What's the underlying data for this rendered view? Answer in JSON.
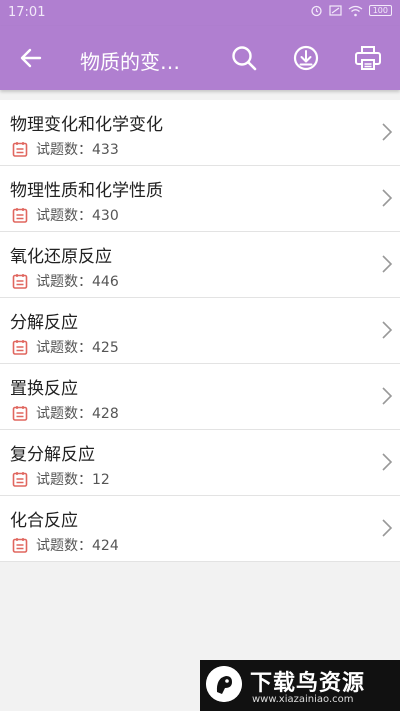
{
  "status_bar": {
    "time": "17:01",
    "battery": "100"
  },
  "app_bar": {
    "title": "物质的变…",
    "background": "#b07fd0"
  },
  "icons": {
    "back": "back-arrow-icon",
    "search": "search-icon",
    "download": "download-icon",
    "print": "print-icon",
    "item": "calendar-icon",
    "chevron": "chevron-right-icon"
  },
  "items": [
    {
      "name": "物理变化和化学变化",
      "count": "试题数：433"
    },
    {
      "name": "物理性质和化学性质",
      "count": "试题数：430"
    },
    {
      "name": "氧化还原反应",
      "count": "试题数：446"
    },
    {
      "name": "分解反应",
      "count": "试题数：425"
    },
    {
      "name": "置换反应",
      "count": "试题数：428"
    },
    {
      "name": "复分解反应",
      "count": "试题数：12"
    },
    {
      "name": "化合反应",
      "count": "试题数：424"
    }
  ],
  "watermark": {
    "brand": "下载鸟资源",
    "url": "www.xiazainiao.com"
  },
  "colors": {
    "accent": "#b07fd0",
    "icon_red": "#e0665f"
  }
}
